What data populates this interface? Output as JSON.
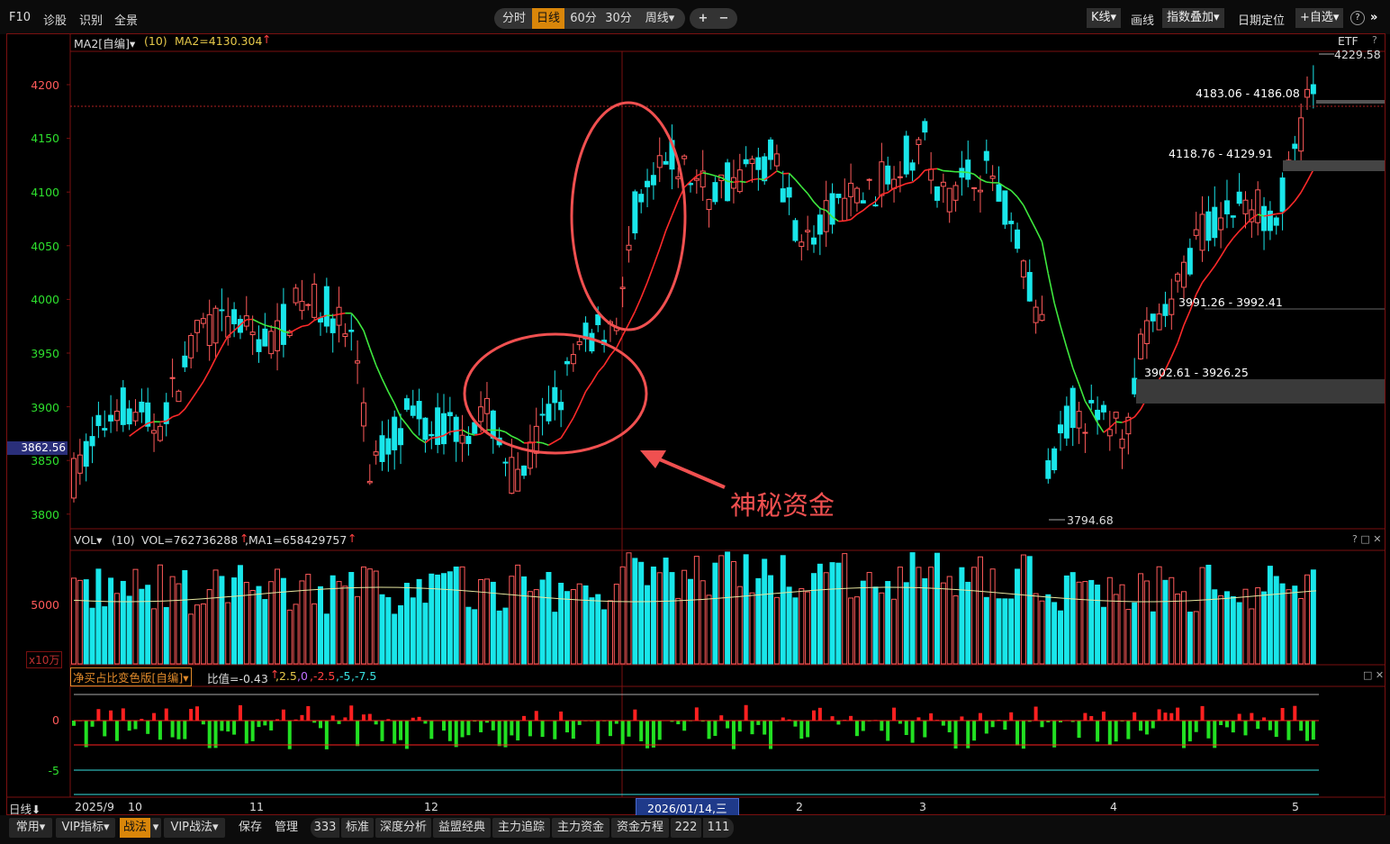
{
  "topbar": {
    "f10": "F10",
    "diagnose": "诊股",
    "recognize": "识别",
    "fullscreen": "全景",
    "periods": [
      "分时",
      "日线",
      "60分",
      "30分",
      "周线▾"
    ],
    "active_period": "日线",
    "zoom_in": "+",
    "zoom_out": "−",
    "kline": "K线▾",
    "draw": "画线",
    "index_overlay": "指数叠加▾",
    "date_locate": "日期定位",
    "self_select": "+自选▾",
    "help": "?",
    "collapse": "»"
  },
  "main_panel": {
    "indicator_name": "MA2[自编]▾",
    "indicator_param": "(10)",
    "indicator_value": "MA2=4130.304",
    "etf": "ETF",
    "help": "?",
    "y_ticks": [
      "4200",
      "4150",
      "4100",
      "4050",
      "4000",
      "3950",
      "3900",
      "3850",
      "3800"
    ],
    "current_price": "3862.56",
    "high_label": "4229.58",
    "low_label": "3794.68",
    "zones": [
      {
        "label": "4183.06 - 4186.08"
      },
      {
        "label": "4118.76 - 4129.91"
      },
      {
        "label": "3991.26 - 3992.41"
      },
      {
        "label": "3902.61 - 3926.25"
      }
    ],
    "annotation_text": "神秘资金"
  },
  "vol_panel": {
    "name": "VOL▾",
    "param": "(10)",
    "value": "VOL=762736288",
    "ma": ",MA1=658429757",
    "y_tick": "5000",
    "unit": "x10万",
    "controls": "? □ ✕"
  },
  "ratio_panel": {
    "name": "净买占比变色版[自编]▾",
    "value_label": "比值=-0.43",
    "levels": [
      ",2.5",
      ",0",
      ",-2.5",
      ",-5",
      ",-7.5"
    ],
    "y_ticks": [
      "0",
      "-5"
    ],
    "controls": "□ ✕"
  },
  "x_axis": {
    "period": "日线⬇",
    "labels": [
      "2025/9",
      "10",
      "11",
      "12",
      "2",
      "3",
      "4",
      "5"
    ],
    "cursor_date": "2026/01/14,三"
  },
  "bottombar": {
    "items": [
      "常用▾",
      "VIP指标▾",
      "战法",
      "▾",
      "VIP战法▾",
      "保存",
      "管理",
      "333",
      "标准",
      "深度分析",
      "益盟经典",
      "主力追踪",
      "主力资金",
      "资金方程",
      "222",
      "111"
    ],
    "active": "战法"
  },
  "colors": {
    "up": "#ff5a5a",
    "down": "#19e6ea",
    "ma_up": "#ff2a2a",
    "ma_down": "#3ee83e",
    "grid": "#7a1010",
    "accent": "#d9860a",
    "annotation": "#f05050"
  }
}
